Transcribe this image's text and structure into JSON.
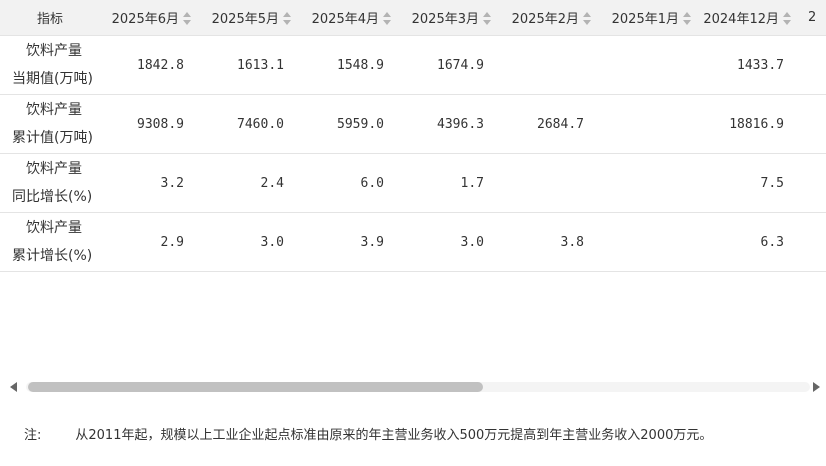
{
  "table": {
    "header_first": "指标",
    "columns": [
      "2025年6月",
      "2025年5月",
      "2025年4月",
      "2025年3月",
      "2025年2月",
      "2025年1月",
      "2024年12月",
      "2"
    ],
    "rows": [
      {
        "name_line1": "饮料产量",
        "name_line2": "当期值(万吨)",
        "values": [
          "1842.8",
          "1613.1",
          "1548.9",
          "1674.9",
          "",
          "",
          "1433.7"
        ]
      },
      {
        "name_line1": "饮料产量",
        "name_line2": "累计值(万吨)",
        "values": [
          "9308.9",
          "7460.0",
          "5959.0",
          "4396.3",
          "2684.7",
          "",
          "18816.9"
        ]
      },
      {
        "name_line1": "饮料产量",
        "name_line2": "同比增长(%)",
        "values": [
          "3.2",
          "2.4",
          "6.0",
          "1.7",
          "",
          "",
          "7.5"
        ]
      },
      {
        "name_line1": "饮料产量",
        "name_line2": "累计增长(%)",
        "values": [
          "2.9",
          "3.0",
          "3.9",
          "3.0",
          "3.8",
          "",
          "6.3"
        ]
      }
    ]
  },
  "note": {
    "label": "注:",
    "text": "从2011年起，规模以上工业企业起点标准由原来的年主营业务收入500万元提高到年主营业务收入2000万元。"
  },
  "scrollbar": {
    "position_fraction": 0.0,
    "visible_fraction": 0.58
  }
}
